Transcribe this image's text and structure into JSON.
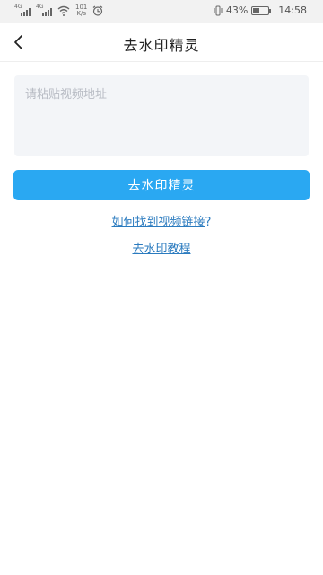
{
  "status_bar": {
    "network_1": "4G",
    "network_2": "4G",
    "speed_value": "101",
    "speed_unit": "K/s",
    "battery_percent": "43%",
    "battery_level": 0.43,
    "time": "14:58"
  },
  "app_bar": {
    "title": "去水印精灵",
    "back_icon": "chevron-left-icon"
  },
  "form": {
    "url_placeholder": "请粘贴视频地址",
    "url_value": "",
    "submit_label": "去水印精灵"
  },
  "links": {
    "help_label": "如何找到视频链接",
    "help_suffix": "?",
    "tutorial_label": "去水印教程"
  },
  "colors": {
    "primary": "#2aa8f2",
    "link": "#2b7bbf",
    "input_bg": "#f3f5f8",
    "status_bg": "#f2f2f2"
  }
}
